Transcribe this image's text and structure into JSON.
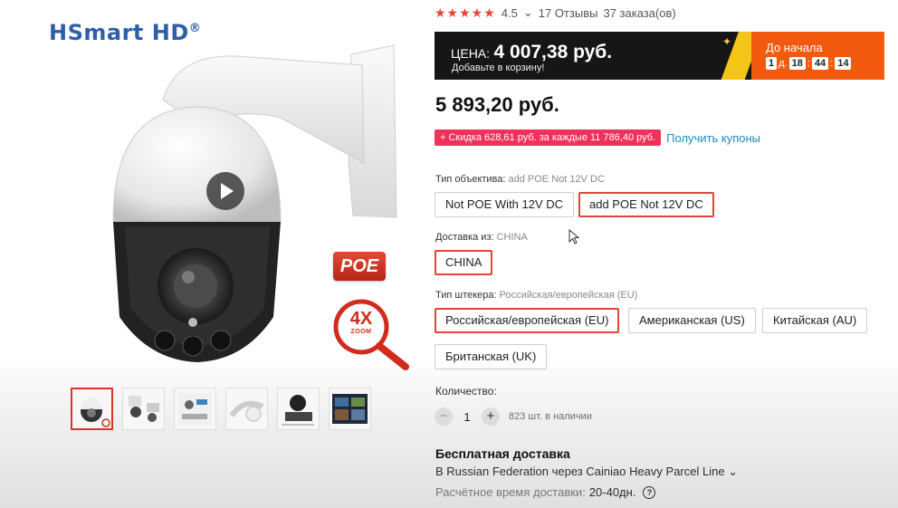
{
  "gallery": {
    "brand": "HSmart HD",
    "brand_mark": "®",
    "poe_badge": "POE",
    "zoom_badge": "4X",
    "zoom_small": "ZOOM",
    "thumbnails": [
      "thumb-1",
      "thumb-2",
      "thumb-3",
      "thumb-4",
      "thumb-5",
      "thumb-6"
    ]
  },
  "rating": {
    "stars": "★★★★★",
    "score": "4.5",
    "reviews": "17 Отзывы",
    "orders": "37 заказа(ов)"
  },
  "promo": {
    "price_label": "ЦЕНА:",
    "price_value": "4 007,38 руб.",
    "subtitle": "Добавьте в корзину!",
    "countdown_label": "До начала",
    "days": "1",
    "days_unit": "д.",
    "hours": "18",
    "minutes": "44",
    "seconds": "14"
  },
  "price": "5 893,20 руб.",
  "discount": {
    "tag": "+ Скидка 628,61 руб. за каждые 11 786,40 руб.",
    "coupon_link": "Получить купоны"
  },
  "options": {
    "lens": {
      "label": "Тип объектива:",
      "selected": "add POE Not 12V DC",
      "choices": [
        "Not POE With 12V DC",
        "add POE Not 12V DC"
      ]
    },
    "ship_from": {
      "label": "Доставка из:",
      "selected": "CHINA",
      "choices": [
        "CHINA"
      ]
    },
    "plug": {
      "label": "Тип штекера:",
      "selected": "Российская/европейская (EU)",
      "choices": [
        "Российская/европейская (EU)",
        "Американская (US)",
        "Китайская (AU)",
        "Британская (UK)"
      ]
    }
  },
  "quantity": {
    "label": "Количество:",
    "minus": "−",
    "value": "1",
    "plus": "+",
    "stock": "823 шт. в наличии"
  },
  "shipping": {
    "title": "Бесплатная доставка",
    "route": "В Russian Federation через Cainiao Heavy Parcel Line ⌄",
    "estimate_label": "Расчётное время доставки:",
    "estimate_value": "20-40дн.",
    "help": "?"
  },
  "colors": {
    "accent_red": "#e0463a",
    "promo_orange": "#f25a0f",
    "link_blue": "#1a8db8",
    "brand_blue": "#2c5fa8"
  }
}
